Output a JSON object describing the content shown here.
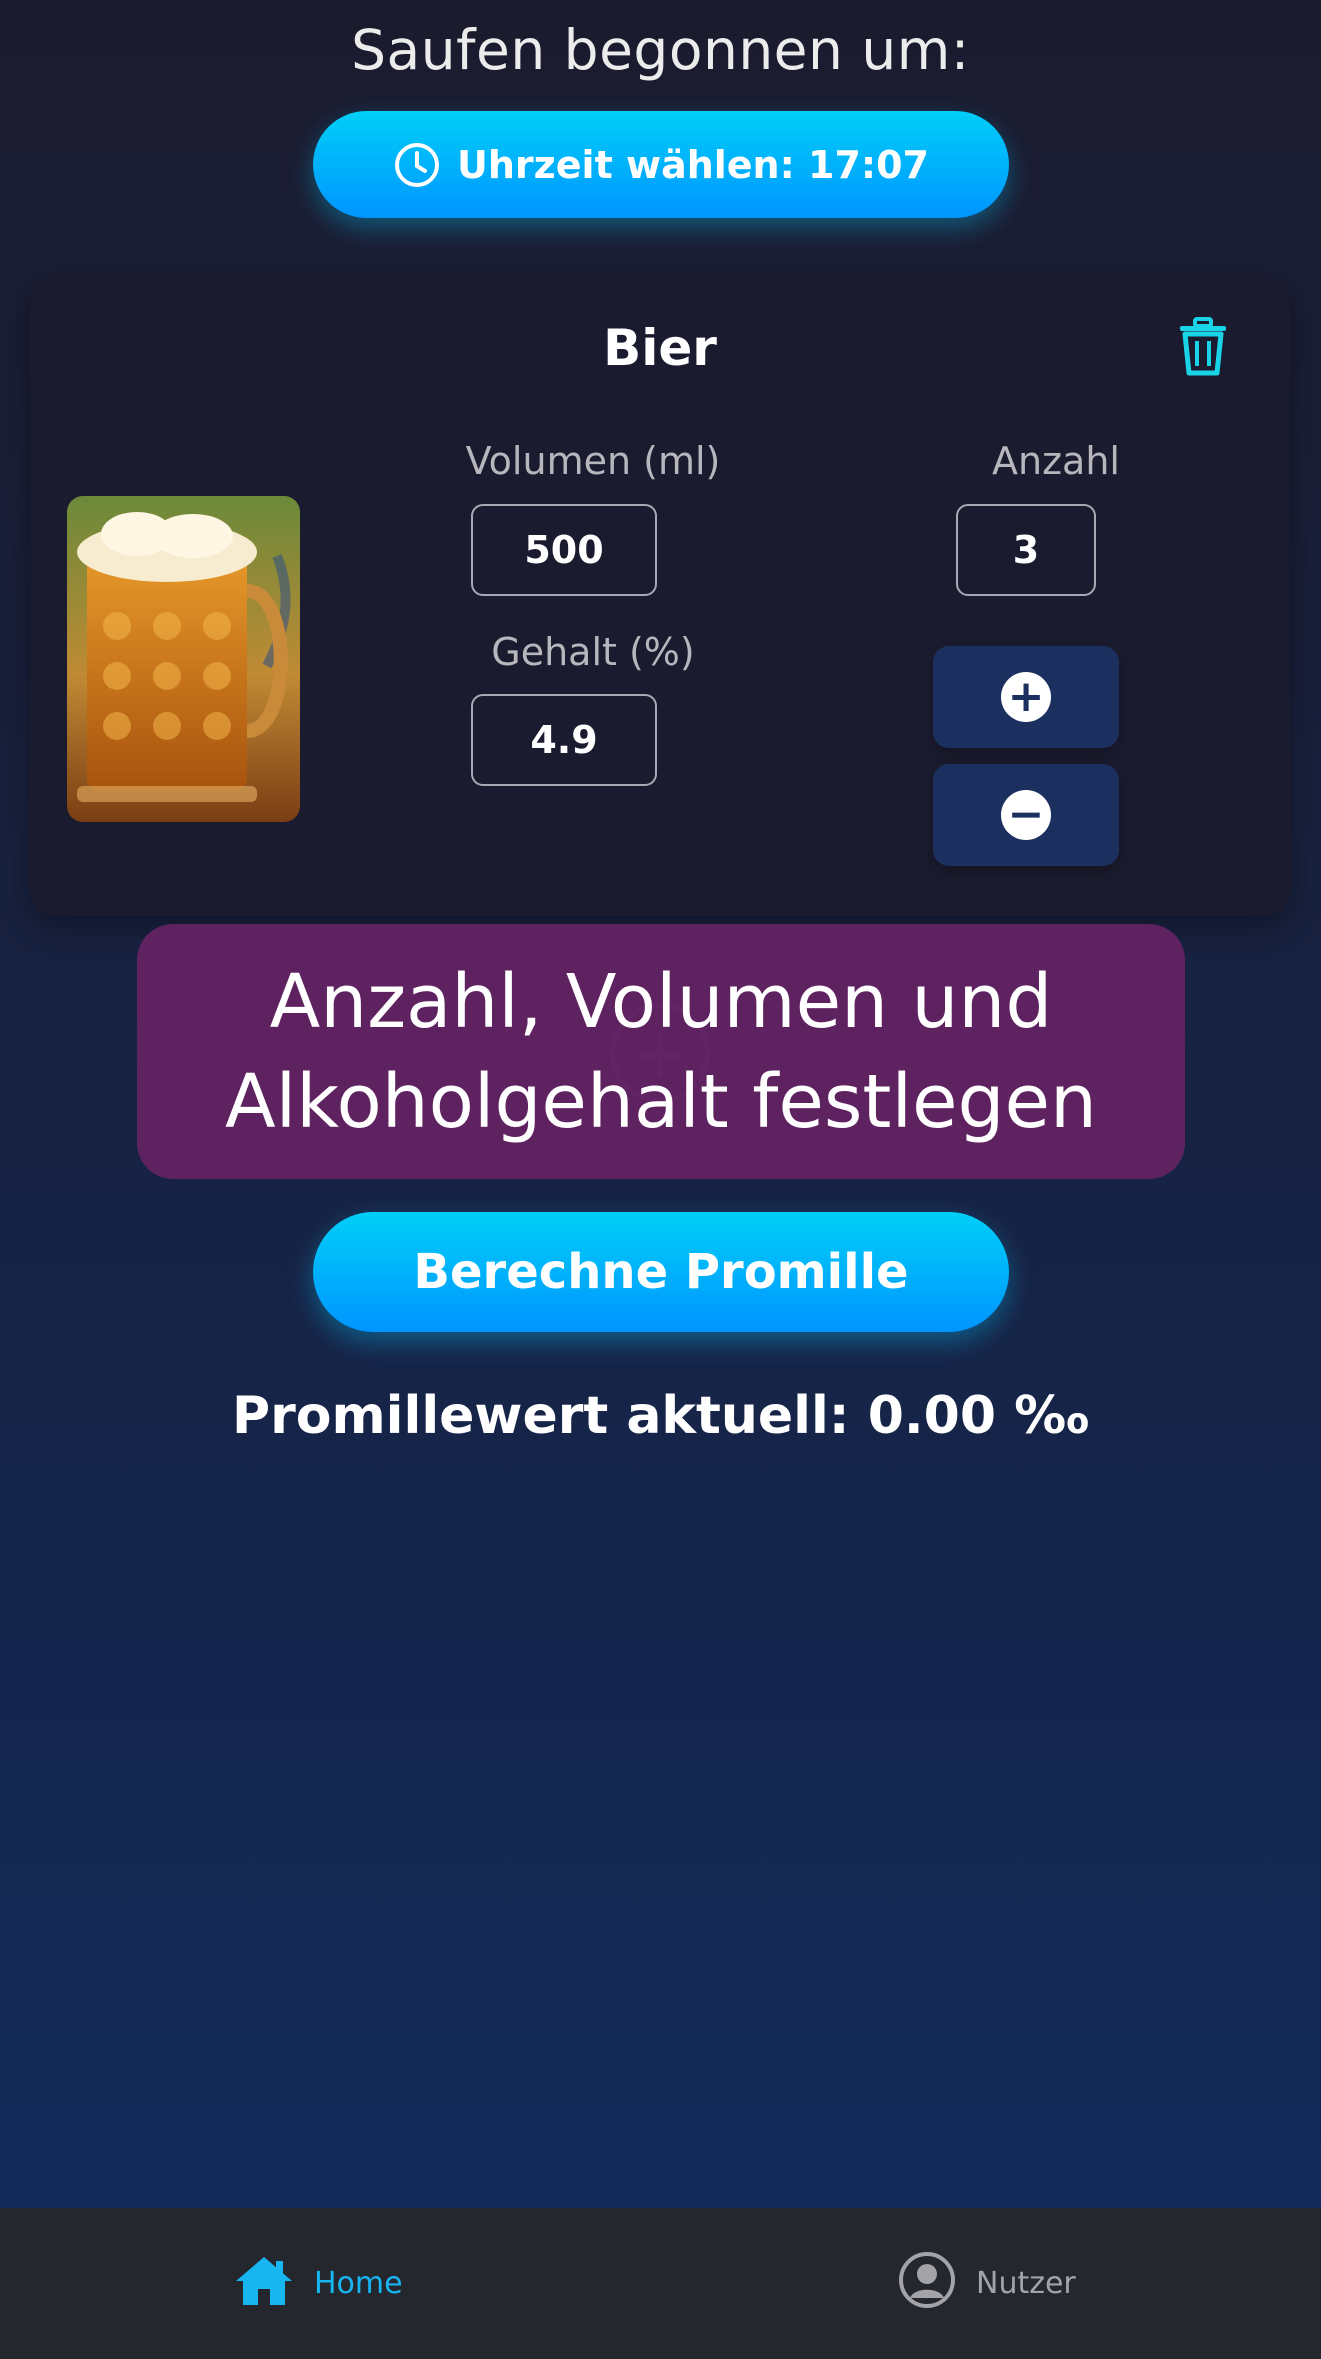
{
  "header": {
    "start_label": "Saufen begonnen um:",
    "time_button_label": "Uhrzeit wählen: 17:07"
  },
  "drink_card": {
    "name": "Bier",
    "volume_label": "Volumen (ml)",
    "volume_value": "500",
    "content_label": "Gehalt (%)",
    "content_value": "4.9",
    "count_label": "Anzahl",
    "count_value": "3"
  },
  "tooltip": {
    "line1": "Anzahl, Volumen und",
    "line2": "Alkoholgehalt festlegen"
  },
  "calculate_button_label": "Berechne Promille",
  "result_text": "Promillewert aktuell: 0.00 ‰",
  "bottom_nav": {
    "home_label": "Home",
    "user_label": "Nutzer"
  },
  "colors": {
    "accent": "#00c2ff",
    "nav_active": "#17b6f0",
    "tooltip_bg": "#622262",
    "trash": "#18d4e6"
  },
  "icons": {
    "time": "clock-icon",
    "delete": "trash-icon",
    "increment": "plus-circle-icon",
    "decrement": "minus-circle-icon",
    "add_drink": "add-circle-icon",
    "home": "home-icon",
    "user": "user-icon"
  }
}
